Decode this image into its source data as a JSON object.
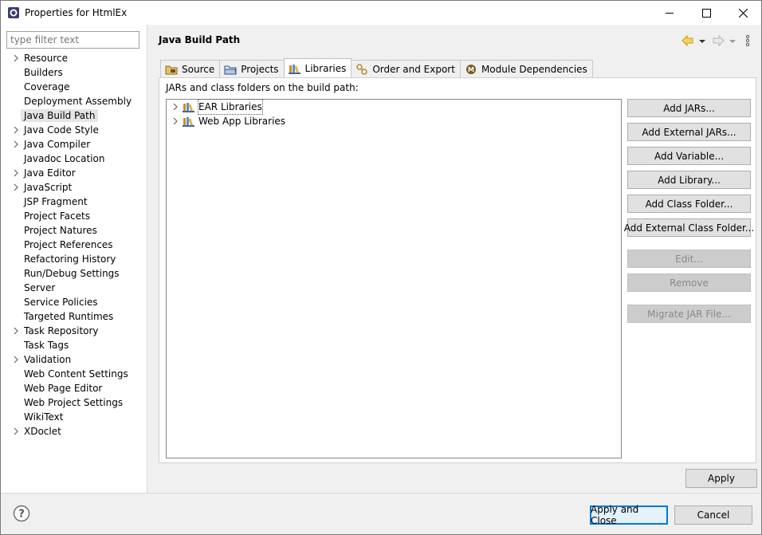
{
  "window": {
    "title": "Properties for HtmlEx",
    "icon": "eclipse-icon"
  },
  "filter": {
    "placeholder": "type filter text",
    "value": ""
  },
  "nav": {
    "items": [
      {
        "label": "Resource",
        "expandable": true
      },
      {
        "label": "Builders",
        "expandable": false
      },
      {
        "label": "Coverage",
        "expandable": false
      },
      {
        "label": "Deployment Assembly",
        "expandable": false
      },
      {
        "label": "Java Build Path",
        "expandable": false,
        "selected": true
      },
      {
        "label": "Java Code Style",
        "expandable": true
      },
      {
        "label": "Java Compiler",
        "expandable": true
      },
      {
        "label": "Javadoc Location",
        "expandable": false
      },
      {
        "label": "Java Editor",
        "expandable": true
      },
      {
        "label": "JavaScript",
        "expandable": true
      },
      {
        "label": "JSP Fragment",
        "expandable": false
      },
      {
        "label": "Project Facets",
        "expandable": false
      },
      {
        "label": "Project Natures",
        "expandable": false
      },
      {
        "label": "Project References",
        "expandable": false
      },
      {
        "label": "Refactoring History",
        "expandable": false
      },
      {
        "label": "Run/Debug Settings",
        "expandable": false
      },
      {
        "label": "Server",
        "expandable": false
      },
      {
        "label": "Service Policies",
        "expandable": false
      },
      {
        "label": "Targeted Runtimes",
        "expandable": false
      },
      {
        "label": "Task Repository",
        "expandable": true
      },
      {
        "label": "Task Tags",
        "expandable": false
      },
      {
        "label": "Validation",
        "expandable": true
      },
      {
        "label": "Web Content Settings",
        "expandable": false
      },
      {
        "label": "Web Page Editor",
        "expandable": false
      },
      {
        "label": "Web Project Settings",
        "expandable": false
      },
      {
        "label": "WikiText",
        "expandable": false
      },
      {
        "label": "XDoclet",
        "expandable": true
      }
    ]
  },
  "page": {
    "title": "Java Build Path"
  },
  "tabs": [
    {
      "label": "Source",
      "icon": "source-folder-icon"
    },
    {
      "label": "Projects",
      "icon": "projects-folder-icon"
    },
    {
      "label": "Libraries",
      "icon": "libraries-icon",
      "active": true
    },
    {
      "label": "Order and Export",
      "icon": "order-export-icon"
    },
    {
      "label": "Module Dependencies",
      "icon": "module-icon"
    }
  ],
  "libraries": {
    "caption": "JARs and class folders on the build path:",
    "entries": [
      {
        "label": "EAR Libraries",
        "icon": "library-icon"
      },
      {
        "label": "Web App Libraries",
        "icon": "library-icon"
      }
    ]
  },
  "buttons": {
    "add_jars": "Add JARs...",
    "add_external_jars": "Add External JARs...",
    "add_variable": "Add Variable...",
    "add_library": "Add Library...",
    "add_class_folder": "Add Class Folder...",
    "add_external_class_folder": "Add External Class Folder...",
    "edit": "Edit...",
    "remove": "Remove",
    "migrate_jar": "Migrate JAR File...",
    "apply": "Apply",
    "apply_and_close": "Apply and Close",
    "cancel": "Cancel"
  },
  "colors": {
    "accent": "#0078d7",
    "nav_arrow": "#d9a320"
  }
}
